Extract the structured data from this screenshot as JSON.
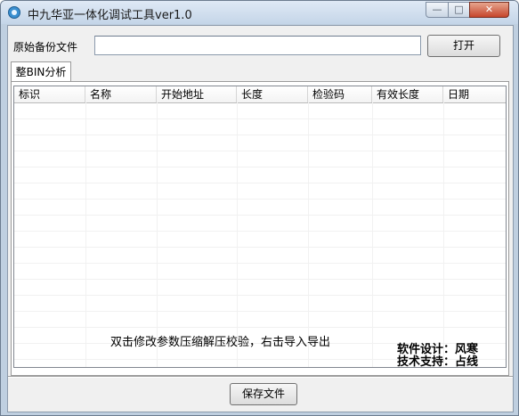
{
  "window": {
    "title": "中九华亚一体化调试工具ver1.0",
    "controls": {
      "minimize": "—",
      "maximize": "□",
      "close": "✕"
    }
  },
  "file_row": {
    "label": "原始备份文件",
    "input_value": "",
    "open_button": "打开"
  },
  "tabs": [
    {
      "label": "整BIN分析",
      "selected": true
    }
  ],
  "table": {
    "columns": [
      "标识",
      "名称",
      "开始地址",
      "长度",
      "检验码",
      "有效长度",
      "日期"
    ],
    "rows": []
  },
  "hint": "双击修改参数压缩解压校验，右击导入导出",
  "credits": {
    "design": "软件设计：风寒",
    "support": "技术支持：占线"
  },
  "save_button": "保存文件",
  "colors": {
    "accent": "#3a8fd0",
    "face": "#f0f0f0",
    "frame": "#bfcfe0"
  }
}
